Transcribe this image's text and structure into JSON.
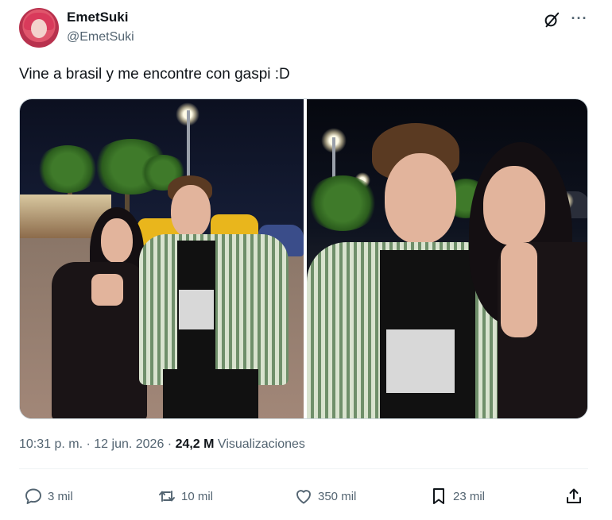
{
  "author": {
    "display_name": "EmetSuki",
    "handle": "@EmetSuki"
  },
  "post": {
    "text": "Vine a brasil y me encontre con gaspi :D",
    "timestamp": "10:31 p. m. · 12 jun. 2026 · ",
    "views_count": "24,2 M",
    "views_label": " Visualizaciones"
  },
  "actions": {
    "replies": "3 mil",
    "reposts": "10 mil",
    "likes": "350 mil",
    "bookmarks": "23 mil"
  },
  "icons": {
    "grok": "grok-icon",
    "more": "more-icon",
    "reply": "reply-icon",
    "repost": "repost-icon",
    "like": "heart-icon",
    "bookmark": "bookmark-icon",
    "share": "share-icon"
  },
  "colors": {
    "text_primary": "#0f1419",
    "text_secondary": "#536471",
    "border": "#cfd9de"
  }
}
